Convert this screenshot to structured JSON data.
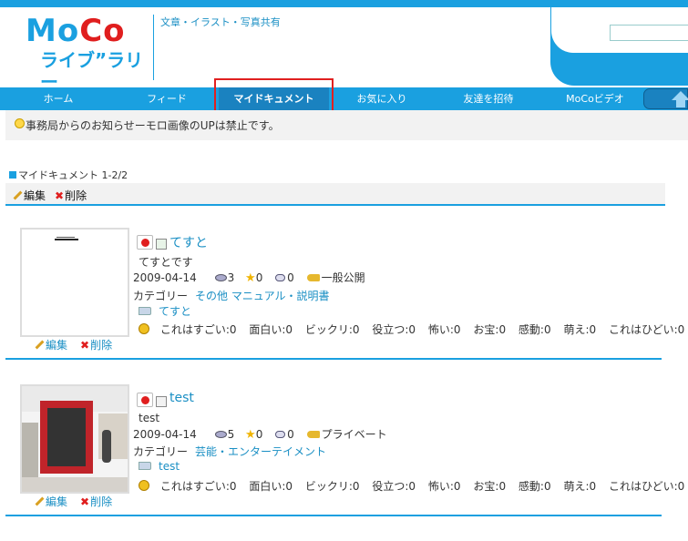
{
  "header": {
    "logo_main_m": "M",
    "logo_main_o": "o",
    "logo_main_c": "C",
    "logo_main_o2": "o",
    "logo_sub": "ライブ”ラリー",
    "tagline": "文章・イラスト・写真共有"
  },
  "nav": {
    "items": [
      {
        "label": "ホーム"
      },
      {
        "label": "フィード"
      },
      {
        "label": "マイドキュメント"
      },
      {
        "label": "お気に入り"
      },
      {
        "label": "友達を招待"
      },
      {
        "label": "MoCoビデオ"
      }
    ],
    "active_index": 2
  },
  "notice": {
    "text": "事務局からのお知らせーモロ画像のUPは禁止です。"
  },
  "section": {
    "title": "マイドキュメント 1-2/2",
    "edit_label": "編集",
    "delete_label": "削除"
  },
  "documents": [
    {
      "title": "てすと",
      "description": "てすとです",
      "date": "2009-04-14",
      "views": "3",
      "stars": "0",
      "comments": "0",
      "visibility": "一般公開",
      "category_label": "カテゴリー",
      "categories": "その他 マニュアル・説明書",
      "tag": "てすと",
      "reactions": [
        "これはすごい:0",
        "面白い:0",
        "ビックリ:0",
        "役立つ:0",
        "怖い:0",
        "お宝:0",
        "感動:0",
        "萌え:0",
        "これはひどい:0"
      ],
      "edit_label": "編集",
      "delete_label": "削除"
    },
    {
      "title": "test",
      "description": "test",
      "date": "2009-04-14",
      "views": "5",
      "stars": "0",
      "comments": "0",
      "visibility": "プライベート",
      "category_label": "カテゴリー",
      "categories": "芸能・エンターテイメント",
      "tag": "test",
      "reactions": [
        "これはすごい:0",
        "面白い:0",
        "ビックリ:0",
        "役立つ:0",
        "怖い:0",
        "お宝:0",
        "感動:0",
        "萌え:0",
        "これはひどい:0"
      ],
      "edit_label": "編集",
      "delete_label": "削除"
    }
  ],
  "colors": {
    "brand_blue": "#1aa0e0",
    "brand_red": "#e01e1e",
    "link": "#1a8fc4"
  }
}
